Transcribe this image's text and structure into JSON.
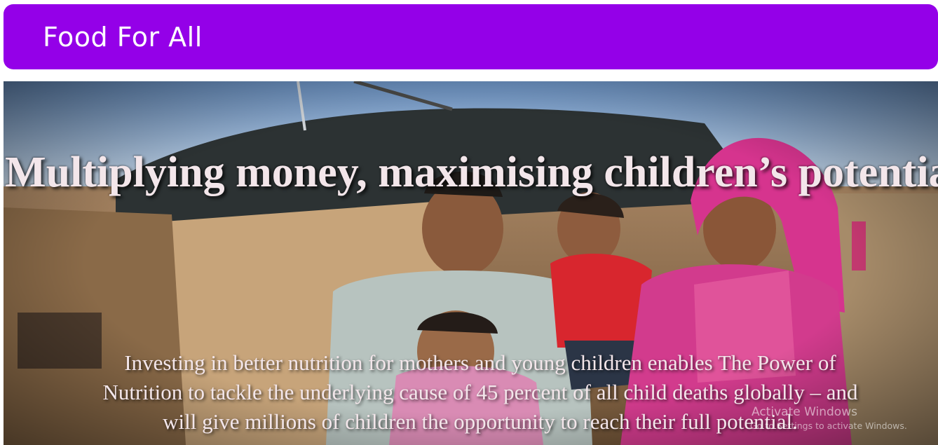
{
  "navbar": {
    "brand": "Food For All",
    "bg_color": "#9400e8"
  },
  "hero": {
    "title": "Multiplying money, maximising children’s potential",
    "text": "Investing in better nutrition for mothers and young children enables The Power of Nutrition to tackle the underlying cause of 45 percent of all child deaths globally – and will give millions of children the opportunity to reach their full potential.",
    "image": "family-photo"
  },
  "watermark": {
    "title": "Activate Windows",
    "subtitle": "Go to Settings to activate Windows."
  }
}
